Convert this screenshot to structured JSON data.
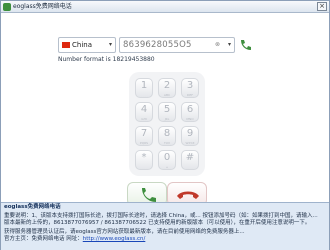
{
  "window": {
    "title": "eoglass免费网络电话",
    "close_glyph": "×"
  },
  "dialer": {
    "country": "China",
    "country_flag_color": "#de2910",
    "phone_number": "8639628055O5",
    "clear_glyph": "⊗",
    "dropdown_glyph": "▾",
    "format_text": "Number format is 18219453880"
  },
  "keypad": [
    {
      "digit": "1",
      "letters": ""
    },
    {
      "digit": "2",
      "letters": "ABC"
    },
    {
      "digit": "3",
      "letters": "DEF"
    },
    {
      "digit": "4",
      "letters": "GHI"
    },
    {
      "digit": "5",
      "letters": "JKL"
    },
    {
      "digit": "6",
      "letters": "MNO"
    },
    {
      "digit": "7",
      "letters": "PQRS"
    },
    {
      "digit": "8",
      "letters": "TUV"
    },
    {
      "digit": "9",
      "letters": "WXYZ"
    },
    {
      "digit": "*",
      "letters": ""
    },
    {
      "digit": "0",
      "letters": "+"
    },
    {
      "digit": "#",
      "letters": ""
    }
  ],
  "colors": {
    "call_green": "#3f8f3f",
    "hangup_red": "#c0392b"
  },
  "notice": {
    "title": "eoglass免费网络电话",
    "line1": "重要说明：1、该版本支持拨打国际长途，拨打国际长途时，请选择 China，或... 按钮添加号码（如：如果拨打到中国，请输入...",
    "line2": "版本最新的上传的，8613877076957 / 861387706522 已支持使用的新版版本（可以使用），在重开后使用注意说明一下。",
    "line3": "获得服务器管理员认证后，请eoglass官方网站获取最新版本，请在目前使用网络的免费服务器上...",
    "line4_prefix": "官方主页：免费网络电话 网址：",
    "link": "http://www.eoglass.cn/"
  }
}
